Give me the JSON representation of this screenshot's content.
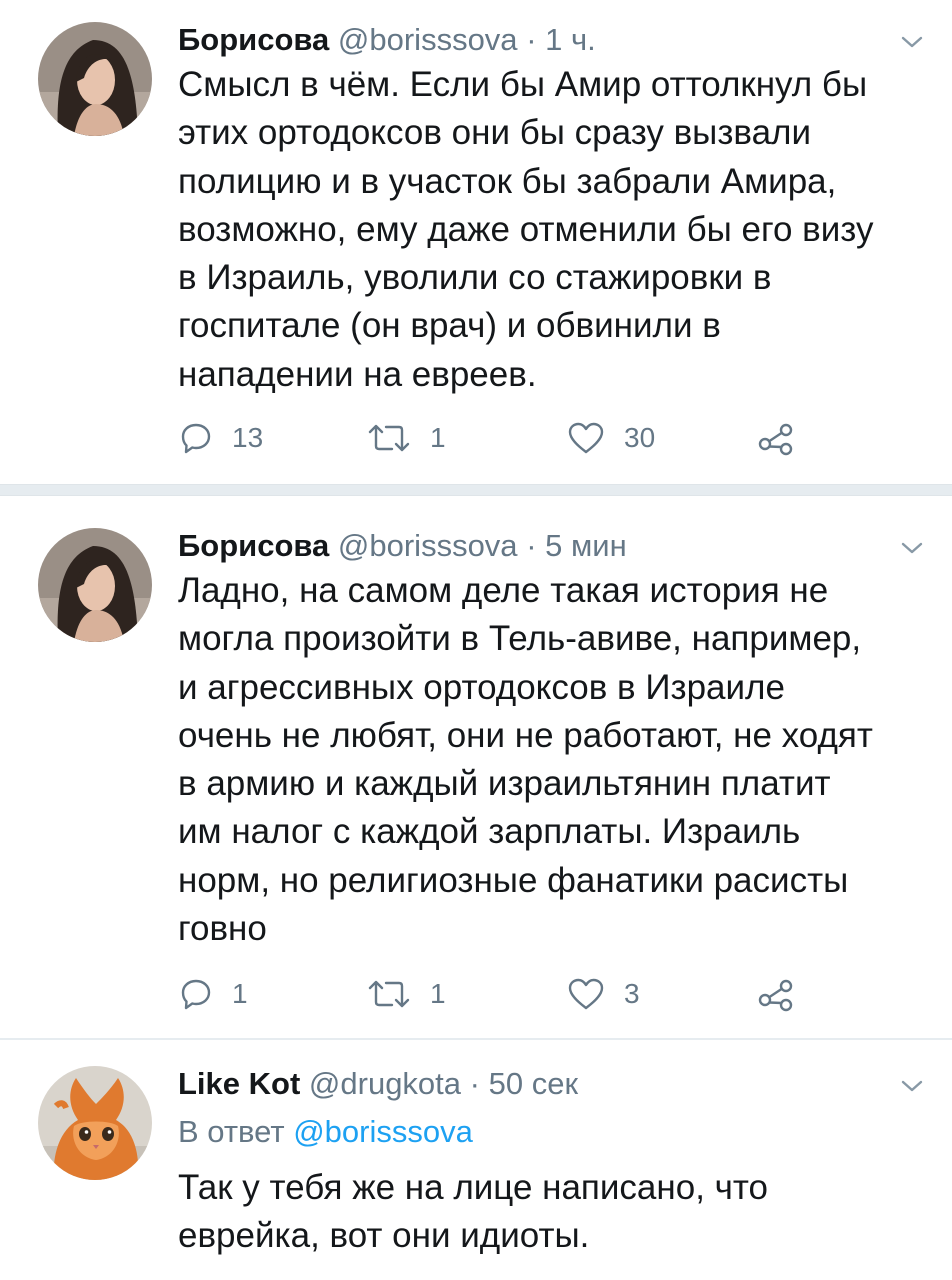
{
  "tweets": [
    {
      "name": "Борисова",
      "handle": "@borisssova",
      "dot": "·",
      "time": "1 ч.",
      "avatar_icon": "user-avatar-photo",
      "lines": [
        "Смысл в чём. Если бы Амир оттолкнул бы",
        "этих ортодоксов они бы сразу вызвали",
        "полицию и в участок бы забрали Амира,",
        "возможно, ему даже отменили бы его визу",
        "в Израиль, уволили со стажировки в",
        "госпитале (он врач) и обвинили в",
        "нападении на евреев."
      ],
      "reply_count": "13",
      "retweet_count": "1",
      "like_count": "30"
    },
    {
      "name": "Борисова",
      "handle": "@borisssova",
      "dot": "·",
      "time": "5 мин",
      "avatar_icon": "user-avatar-photo",
      "lines": [
        "Ладно, на самом деле такая история не",
        "могла произойти в Тель-авиве, например,",
        "и агрессивных ортодоксов в Израиле",
        "очень не любят, они не работают, не ходят",
        "в армию и каждый израильтянин платит",
        "им налог с каждой зарплаты. Израиль",
        "норм, но религиозные фанатики расисты",
        "говно"
      ],
      "reply_count": "1",
      "retweet_count": "1",
      "like_count": "3"
    },
    {
      "name": "Like Kot",
      "handle": "@drugkota",
      "dot": "·",
      "time": "50 сек",
      "avatar_icon": "kitten-avatar-photo",
      "reply_prefix": "В ответ",
      "reply_handle": "@borisssova",
      "lines": [
        "Так у тебя же на лице написано, что",
        "еврейка, вот они идиоты."
      ]
    }
  ],
  "colors": {
    "text": "#14171a",
    "secondary": "#657786",
    "link": "#1da1f2",
    "separator": "#e6ecf0"
  },
  "icons": {
    "reply": "reply-icon",
    "retweet": "retweet-icon",
    "like": "heart-icon",
    "share": "share-icon",
    "menu": "chevron-down-icon"
  }
}
